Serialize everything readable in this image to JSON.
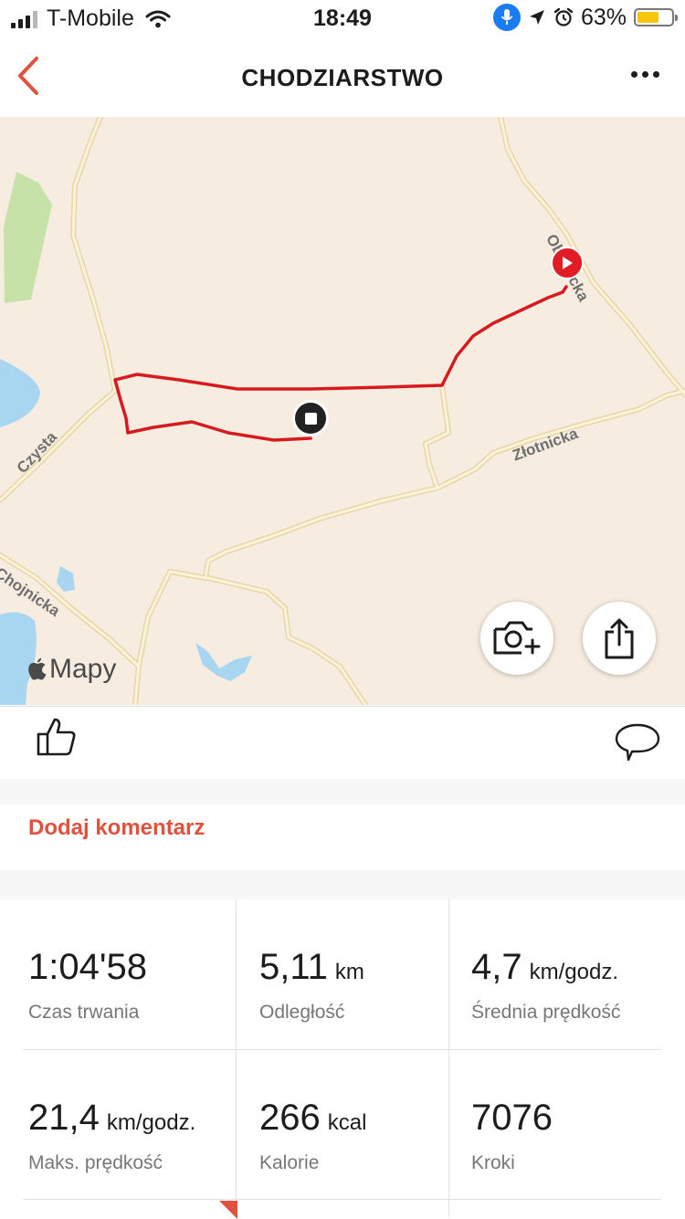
{
  "status_bar": {
    "carrier": "T-Mobile",
    "time": "18:49",
    "battery": "63%",
    "battery_level": 0.63
  },
  "nav": {
    "title": "CHODZIARSTWO"
  },
  "map": {
    "streets": {
      "czysta": "Czysta",
      "chojnicka": "Chojnicka",
      "zlotnicka": "Złotnicka",
      "obornicka": "Ob      cka"
    },
    "logo": "Mapy"
  },
  "actions": {
    "add_comment": "Dodaj komentarz"
  },
  "stats": [
    {
      "value": "1:04'58",
      "unit": "",
      "label": "Czas trwania"
    },
    {
      "value": "5,11",
      "unit": "km",
      "label": "Odległość"
    },
    {
      "value": "4,7",
      "unit": "km/godz.",
      "label": "Średnia prędkość"
    },
    {
      "value": "21,4",
      "unit": "km/godz.",
      "label": "Maks. prędkość"
    },
    {
      "value": "266",
      "unit": "kcal",
      "label": "Kalorie"
    },
    {
      "value": "7076",
      "unit": "",
      "label": "Kroki"
    }
  ],
  "colors": {
    "accent": "#e0523e",
    "route": "#d71920",
    "map_background": "#f6ece0"
  }
}
